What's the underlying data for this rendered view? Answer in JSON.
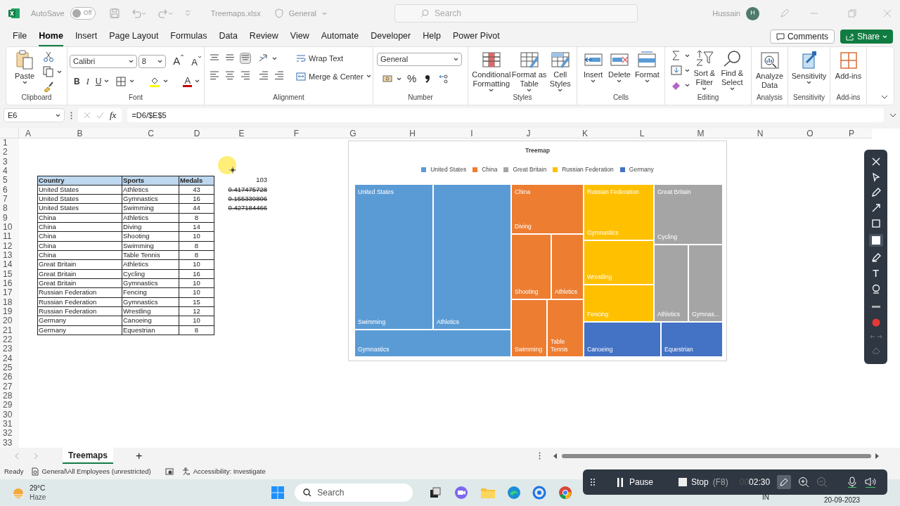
{
  "title_bar": {
    "autosave_label": "AutoSave",
    "autosave": {
      "on": false,
      "label": "Off"
    },
    "file_name": "Treemaps.xlsx",
    "sensitivity_label": "General",
    "search_placeholder": "Search",
    "user_name": "Hussain",
    "avatar_initial": "H"
  },
  "menu_tabs": [
    {
      "label": "File",
      "selected": false
    },
    {
      "label": "Home",
      "selected": true
    },
    {
      "label": "Insert",
      "selected": false
    },
    {
      "label": "Page Layout",
      "selected": false
    },
    {
      "label": "Formulas",
      "selected": false
    },
    {
      "label": "Data",
      "selected": false
    },
    {
      "label": "Review",
      "selected": false
    },
    {
      "label": "View",
      "selected": false
    },
    {
      "label": "Automate",
      "selected": false
    },
    {
      "label": "Developer",
      "selected": false
    },
    {
      "label": "Help",
      "selected": false
    },
    {
      "label": "Power Pivot",
      "selected": false
    }
  ],
  "comments_button": "Comments",
  "share_button": "Share",
  "ribbon": {
    "clipboard": {
      "paste": "Paste",
      "label": "Clipboard"
    },
    "font": {
      "font_name": "Calibri",
      "font_size": "8",
      "grow": "A",
      "shrink": "A",
      "bold": "B",
      "italic": "I",
      "underline": "U",
      "font_color": "A",
      "label": "Font"
    },
    "alignment": {
      "wrap_text": "Wrap Text",
      "merge_center": "Merge & Center",
      "label": "Alignment"
    },
    "number": {
      "format": "General",
      "percent": "%",
      "label": "Number"
    },
    "styles": {
      "buttons": [
        "Conditional Formatting",
        "Format as Table",
        "Cell Styles"
      ],
      "label": "Styles"
    },
    "cells": {
      "buttons": [
        "Insert",
        "Delete",
        "Format"
      ],
      "label": "Cells"
    },
    "editing": {
      "buttons": [
        "Sort & Filter",
        "Find & Select"
      ],
      "label": "Editing"
    },
    "analysis": {
      "button": "Analyze Data",
      "label": "Analysis"
    },
    "sensitivity": {
      "button": "Sensitivity",
      "label": "Sensitivity"
    },
    "addins": {
      "button": "Add-ins",
      "label": "Add-ins"
    }
  },
  "formula_bar": {
    "name_box": "E6",
    "fx": "fx",
    "formula": "=D6/$E$5"
  },
  "sheet": {
    "columns": [
      "A",
      "B",
      "C",
      "D",
      "E",
      "F",
      "G",
      "H",
      "I",
      "J",
      "K",
      "L",
      "M",
      "N",
      "O",
      "P"
    ],
    "rows": [
      "1",
      "2",
      "3",
      "4",
      "5",
      "6",
      "7",
      "8",
      "9",
      "10",
      "11",
      "12",
      "13",
      "14",
      "15",
      "16",
      "17",
      "18",
      "19",
      "20",
      "21",
      "22",
      "23",
      "24",
      "25",
      "26",
      "27",
      "28",
      "29",
      "30",
      "31",
      "32",
      "33"
    ],
    "table": {
      "columns": [
        "Country",
        "Sports",
        "Medals"
      ],
      "rows": [
        [
          "United States",
          "Athletics",
          "43"
        ],
        [
          "United States",
          "Gymnastics",
          "16"
        ],
        [
          "United States",
          "Swimming",
          "44"
        ],
        [
          "China",
          "Athletics",
          "8"
        ],
        [
          "China",
          "Diving",
          "14"
        ],
        [
          "China",
          "Shooting",
          "10"
        ],
        [
          "China",
          "Swimming",
          "8"
        ],
        [
          "China",
          "Table Tennis",
          "8"
        ],
        [
          "Great Britain",
          "Athletics",
          "10"
        ],
        [
          "Great Britain",
          "Cycling",
          "16"
        ],
        [
          "Great Britain",
          "Gymnastics",
          "10"
        ],
        [
          "Russian Federation",
          "Fencing",
          "10"
        ],
        [
          "Russian Federation",
          "Gymnastics",
          "15"
        ],
        [
          "Russian Federation",
          "Wrestling",
          "12"
        ],
        [
          "Germany",
          "Canoeing",
          "10"
        ],
        [
          "Germany",
          "Equestrian",
          "8"
        ]
      ]
    },
    "helper_values": [
      {
        "value": "103",
        "struck": false
      },
      {
        "value": "0.417475728",
        "struck": true
      },
      {
        "value": "0.155339806",
        "struck": true
      },
      {
        "value": "0.427184466",
        "struck": true
      }
    ]
  },
  "chart": {
    "title": "Treemap",
    "legend": [
      {
        "label": "United States",
        "color": "#5b9bd5"
      },
      {
        "label": "China",
        "color": "#ed7d31"
      },
      {
        "label": "Great Britain",
        "color": "#a5a5a5"
      },
      {
        "label": "Russian Federation",
        "color": "#ffc000"
      },
      {
        "label": "Germany",
        "color": "#4472c4"
      }
    ],
    "tiles": [
      {
        "group_label": "United States",
        "label": "Swimming",
        "color": "#5b9bd5"
      },
      {
        "label": "Athletics",
        "color": "#5b9bd5"
      },
      {
        "label": "Gymnastics",
        "color": "#5b9bd5"
      },
      {
        "group_label": "China",
        "label": "Diving",
        "color": "#ed7d31"
      },
      {
        "label": "Shooting",
        "color": "#ed7d31"
      },
      {
        "label": "Athletics",
        "color": "#ed7d31"
      },
      {
        "label": "Swimming",
        "color": "#ed7d31"
      },
      {
        "label": "Table Tennis",
        "color": "#ed7d31"
      },
      {
        "group_label": "Russian Federation",
        "label": "Gymnastics",
        "color": "#ffc000"
      },
      {
        "label": "Wrestling",
        "color": "#ffc000"
      },
      {
        "label": "Fencing",
        "color": "#ffc000"
      },
      {
        "group_label": "Great Britain",
        "label": "Cycling",
        "color": "#a5a5a5"
      },
      {
        "label": "Athletics",
        "color": "#a5a5a5"
      },
      {
        "label": "Gymnas...",
        "color": "#a5a5a5"
      },
      {
        "label": "Canoeing",
        "color": "#4472c4"
      },
      {
        "label": "Equestrian",
        "color": "#4472c4"
      }
    ]
  },
  "sheet_tabs": [
    {
      "label": "Treemaps",
      "selected": true
    }
  ],
  "add_sheet": "+",
  "status_bar": {
    "ready": "Ready",
    "sensitivity": "General\\All Employees (unrestricted)",
    "accessibility": "Accessibility: Investigate"
  },
  "taskbar": {
    "temperature": "29°C",
    "weather": "Haze",
    "search_placeholder": "Search",
    "language": "IN",
    "date": "20-09-2023"
  },
  "annotation_toolbar": {
    "text_tool": "T"
  },
  "recorder": {
    "pause": "Pause",
    "stop": "Stop",
    "stop_shortcut": "(F8)",
    "time_faded": "00",
    "time": "02:30"
  }
}
